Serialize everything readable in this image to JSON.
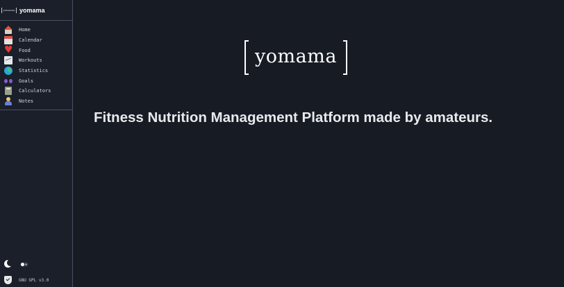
{
  "sidebar": {
    "mini_logo_text": "yomama",
    "brand_name": "yomama",
    "items": [
      {
        "label": "Home",
        "icon": "home-icon"
      },
      {
        "label": "Calendar",
        "icon": "calendar-icon"
      },
      {
        "label": "Food",
        "icon": "heart-icon"
      },
      {
        "label": "Workouts",
        "icon": "chart-icon"
      },
      {
        "label": "Statistics",
        "icon": "globe-icon"
      },
      {
        "label": "Goals",
        "icon": "goggles-icon"
      },
      {
        "label": "Calculators",
        "icon": "calculator-icon"
      },
      {
        "label": "Notes",
        "icon": "person-icon"
      }
    ],
    "theme_toggle_icon": "moon-icon",
    "license_icon": "shield-icon",
    "license_text": "GNU GPL v3.0"
  },
  "main": {
    "logo_text": "yomama",
    "tagline": "Fitness Nutrition Management Platform made by amateurs."
  },
  "colors": {
    "background": "#171b24",
    "sidebar_background": "#1a1f29",
    "divider": "#4a5160",
    "text": "#e8eaed"
  }
}
